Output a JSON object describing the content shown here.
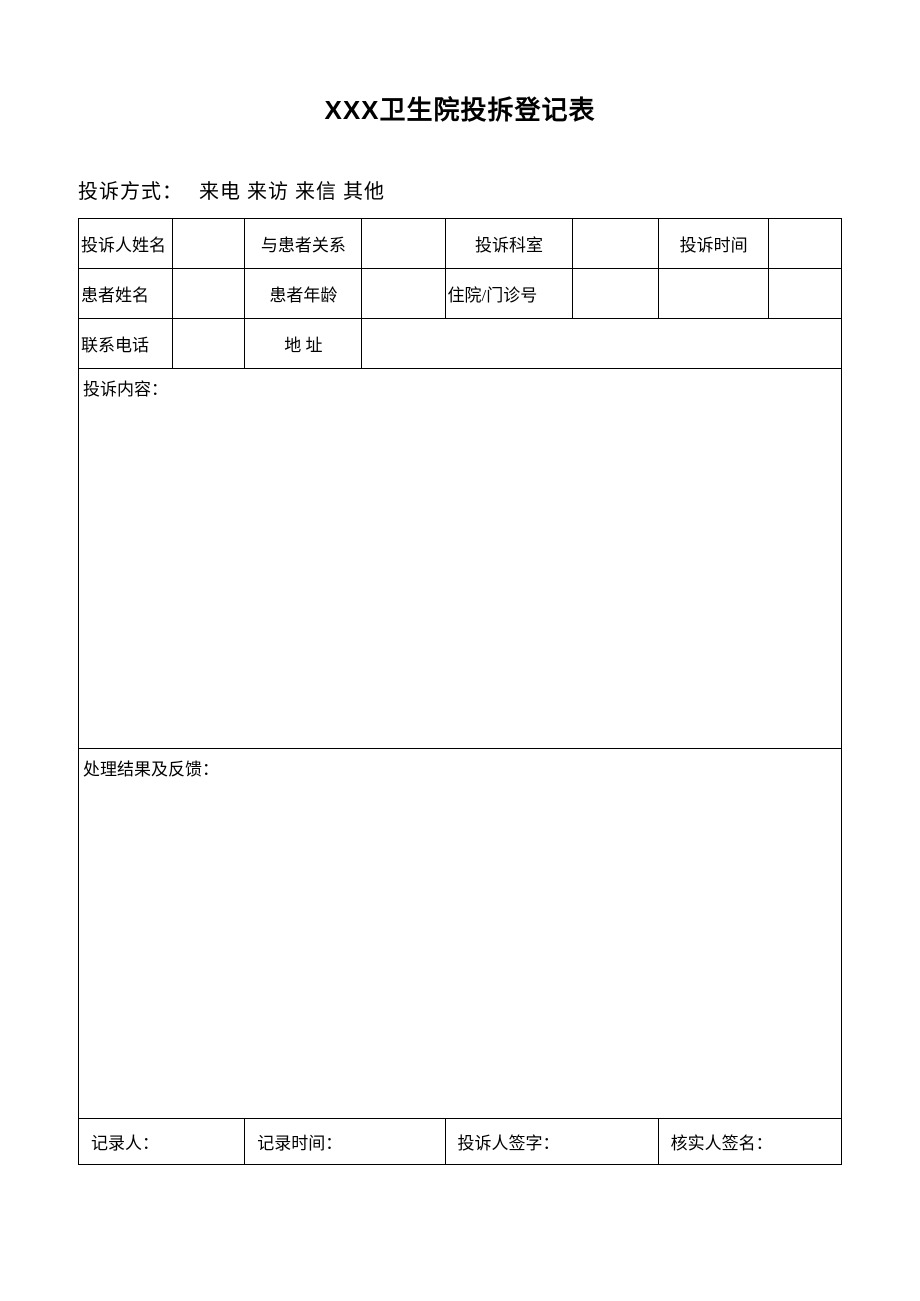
{
  "title": "XXX卫生院投拆登记表",
  "method": {
    "label": "投诉方式：",
    "options": "来电 来访 来信 其他"
  },
  "row1": {
    "c1": "投诉人姓名",
    "c3": "与患者关系",
    "c5": "投诉科室",
    "c7": "投诉时间"
  },
  "row2": {
    "c1": "患者姓名",
    "c3": "患者年龄",
    "c5": "住院/门诊号"
  },
  "row3": {
    "c1": "联系电话",
    "c3": "地  址"
  },
  "content_label": "投诉内容：",
  "result_label": "处理结果及反馈：",
  "footer": {
    "c1": "记录人：",
    "c2": "记录时间：",
    "c3": "投诉人签字：",
    "c4": "核实人签名："
  }
}
